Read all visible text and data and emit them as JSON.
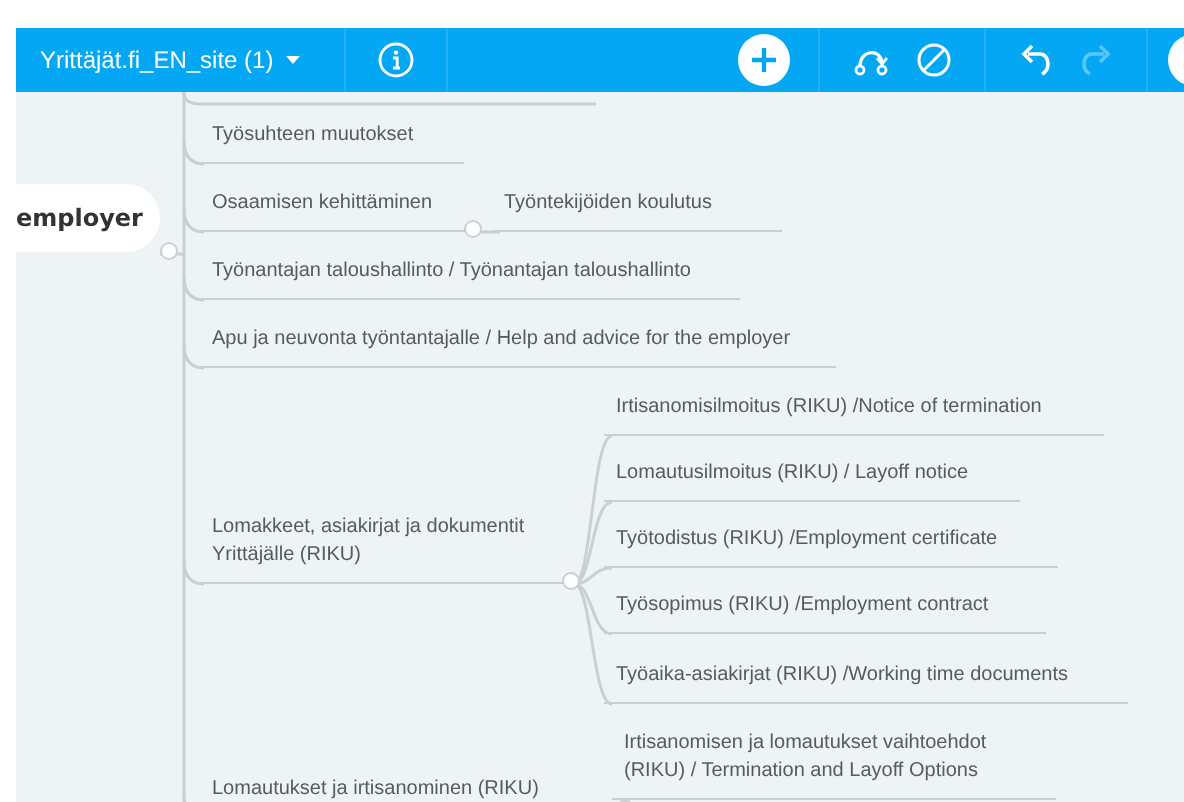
{
  "toolbar": {
    "title": "Yrittäjät.fi_EN_site (1)",
    "undo": {
      "disabled": false
    },
    "redo": {
      "disabled": true
    }
  },
  "mindmap": {
    "root": "employer",
    "branches": [
      {
        "label": "Työsuhteen muutokset"
      },
      {
        "label": "Osaamisen kehittäminen",
        "children": [
          {
            "label": "Työntekijöiden koulutus"
          }
        ]
      },
      {
        "label": "Työnantajan taloushallinto / Työnantajan taloushallinto"
      },
      {
        "label": "Apu ja neuvonta työntantajalle / Help and advice for the employer"
      },
      {
        "label": "Lomakkeet, asiakirjat ja dokumentit Yrittäjälle (RIKU)",
        "children": [
          {
            "label": "Irtisanomisilmoitus (RIKU) /Notice of termination"
          },
          {
            "label": "Lomautusilmoitus (RIKU) / Layoff notice"
          },
          {
            "label": "Työtodistus (RIKU) /Employment certificate"
          },
          {
            "label": "Työsopimus (RIKU) /Employment contract"
          },
          {
            "label": "Työaika-asiakirjat (RIKU) /Working time documents"
          }
        ]
      },
      {
        "label": "Lomautukset ja irtisanominen (RIKU)",
        "children": [
          {
            "label": "Irtisanomisen ja lomautukset vaihtoehdot (RIKU) / Termination and Layoff Options"
          }
        ]
      }
    ]
  }
}
